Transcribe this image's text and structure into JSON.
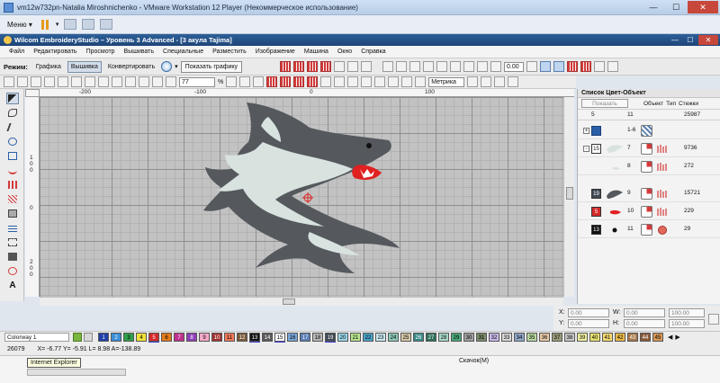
{
  "vm": {
    "title": "vm12w732pn-Natalia Miroshnichenko - VMware Workstation 12 Player (Некоммерческое использование)",
    "menu_label": "Меню ▾"
  },
  "app": {
    "title": "Wilcom EmbroideryStudio – Уровень 3 Advanced - [3 акула     Tajima]"
  },
  "menu": [
    "Файл",
    "Редактировать",
    "Просмотр",
    "Вышивать",
    "Специальные",
    "Разместить",
    "Изображение",
    "Машина",
    "Окно",
    "Справка"
  ],
  "mode_toolbar": {
    "label": "Режим:",
    "modes": [
      {
        "label": "Графика",
        "active": false
      },
      {
        "label": "Вышивка",
        "active": true
      },
      {
        "label": "Конвертировать",
        "active": false
      }
    ],
    "show_graphic": "Показать графику",
    "angle_value": "0.00"
  },
  "tool_row2": {
    "zoom_value": "77",
    "zoom_unit": "%",
    "units": "Метрика"
  },
  "ruler": {
    "top_labels": [
      "-200",
      "-100",
      "0",
      "100"
    ],
    "left_labels": [
      "1",
      "0",
      "0",
      "0",
      "2",
      "0",
      "0"
    ]
  },
  "panel": {
    "title": "Список Цвет-Объект",
    "show_button": "Показать",
    "headers": {
      "object": "Объект",
      "type": "Тип",
      "stitches": "Стежки"
    },
    "totals": {
      "colors": "5",
      "objects": "11",
      "stitches": "25987"
    },
    "rows": [
      {
        "swatch": "",
        "swatch_color": "#ffffff",
        "expander": "+",
        "num": "1-6",
        "count": ""
      },
      {
        "swatch": "15",
        "swatch_color": "#ffffff",
        "expander": "-",
        "num": "7",
        "count": "9736"
      },
      {
        "swatch": "",
        "swatch_color": "#ffffff",
        "expander": "",
        "num": "8",
        "count": "272"
      },
      {
        "swatch": "19",
        "swatch_color": "#3f4a55",
        "expander": "",
        "num": "9",
        "count": "15721"
      },
      {
        "swatch": "5",
        "swatch_color": "#d42a2a",
        "expander": "",
        "num": "10",
        "count": "229"
      },
      {
        "swatch": "13",
        "swatch_color": "#111111",
        "expander": "",
        "num": "11",
        "count": "29"
      }
    ]
  },
  "coords": {
    "x_label": "X:",
    "y_label": "Y:",
    "w_label": "W:",
    "h_label": "H:",
    "x_value": "0.00",
    "y_value": "0.00",
    "w_value": "0.00",
    "h_value": "0.00",
    "w_pct": "100.00",
    "h_pct": "100.00"
  },
  "colorbar": {
    "colorway": "Colorway 1",
    "chips": [
      {
        "n": "1",
        "c": "#1f3fa8",
        "dark": true,
        "ul": false
      },
      {
        "n": "2",
        "c": "#3b8fd6",
        "dark": true,
        "ul": false
      },
      {
        "n": "3",
        "c": "#2fa04a",
        "dark": false,
        "ul": false
      },
      {
        "n": "4",
        "c": "#f1e23a",
        "dark": false,
        "ul": false
      },
      {
        "n": "5",
        "c": "#d42a2a",
        "dark": true,
        "ul": true
      },
      {
        "n": "6",
        "c": "#e37b1d",
        "dark": false,
        "ul": false
      },
      {
        "n": "7",
        "c": "#c0308e",
        "dark": true,
        "ul": false
      },
      {
        "n": "8",
        "c": "#8e3fb8",
        "dark": true,
        "ul": false
      },
      {
        "n": "9",
        "c": "#f3a9c7",
        "dark": false,
        "ul": false
      },
      {
        "n": "10",
        "c": "#a23232",
        "dark": true,
        "ul": false
      },
      {
        "n": "11",
        "c": "#f07a5a",
        "dark": false,
        "ul": false
      },
      {
        "n": "12",
        "c": "#7a5a3a",
        "dark": true,
        "ul": false
      },
      {
        "n": "13",
        "c": "#111111",
        "dark": true,
        "ul": true
      },
      {
        "n": "14",
        "c": "#5a5a5a",
        "dark": true,
        "ul": false
      },
      {
        "n": "15",
        "c": "#ffffff",
        "dark": false,
        "ul": true
      },
      {
        "n": "16",
        "c": "#7aa6d8",
        "dark": false,
        "ul": false
      },
      {
        "n": "17",
        "c": "#5b7fb5",
        "dark": true,
        "ul": false
      },
      {
        "n": "18",
        "c": "#b8b8b8",
        "dark": false,
        "ul": false
      },
      {
        "n": "19",
        "c": "#3f4a55",
        "dark": true,
        "ul": true
      },
      {
        "n": "20",
        "c": "#9bd6e8",
        "dark": false,
        "ul": false
      },
      {
        "n": "21",
        "c": "#b6e28c",
        "dark": false,
        "ul": false
      },
      {
        "n": "22",
        "c": "#4aa3c8",
        "dark": false,
        "ul": false
      },
      {
        "n": "23",
        "c": "#c8e8f0",
        "dark": false,
        "ul": false
      },
      {
        "n": "24",
        "c": "#8cc8b8",
        "dark": false,
        "ul": false
      },
      {
        "n": "25",
        "c": "#d6c8a8",
        "dark": false,
        "ul": false
      },
      {
        "n": "26",
        "c": "#3a8a8a",
        "dark": true,
        "ul": false
      },
      {
        "n": "27",
        "c": "#2f6f5a",
        "dark": true,
        "ul": false
      },
      {
        "n": "28",
        "c": "#a8d8c8",
        "dark": false,
        "ul": false
      },
      {
        "n": "29",
        "c": "#4aa87a",
        "dark": false,
        "ul": false
      },
      {
        "n": "30",
        "c": "#a0a0a0",
        "dark": false,
        "ul": false
      },
      {
        "n": "31",
        "c": "#7a8a6a",
        "dark": false,
        "ul": false
      },
      {
        "n": "32",
        "c": "#c8b8e8",
        "dark": false,
        "ul": false
      },
      {
        "n": "33",
        "c": "#d8d8d8",
        "dark": false,
        "ul": false
      },
      {
        "n": "34",
        "c": "#8fa8c8",
        "dark": false,
        "ul": false
      },
      {
        "n": "35",
        "c": "#b8d8a0",
        "dark": false,
        "ul": false
      },
      {
        "n": "36",
        "c": "#e8c8a8",
        "dark": false,
        "ul": false
      },
      {
        "n": "37",
        "c": "#9a9a7a",
        "dark": false,
        "ul": false
      },
      {
        "n": "38",
        "c": "#c8c8c8",
        "dark": false,
        "ul": false
      },
      {
        "n": "39",
        "c": "#f0f0a0",
        "dark": false,
        "ul": false
      },
      {
        "n": "40",
        "c": "#e8e070",
        "dark": false,
        "ul": false
      },
      {
        "n": "41",
        "c": "#f0d870",
        "dark": false,
        "ul": false
      },
      {
        "n": "42",
        "c": "#e8b848",
        "dark": false,
        "ul": false
      },
      {
        "n": "43",
        "c": "#a87a4a",
        "dark": true,
        "ul": false
      },
      {
        "n": "44",
        "c": "#8a5a3a",
        "dark": true,
        "ul": false
      },
      {
        "n": "45",
        "c": "#d89858",
        "dark": false,
        "ul": false
      }
    ]
  },
  "status": {
    "stitch_count": "26079",
    "coords_text": "X=  -6.77 Y=  -5.91 L=  8.98 A=-138.89",
    "tooltip": "Internet Explorer",
    "download": "Скачок(М)"
  },
  "colors": {
    "shark_dark": "#55595e",
    "shark_light": "#d8e2df",
    "accent_red": "#e02020"
  }
}
